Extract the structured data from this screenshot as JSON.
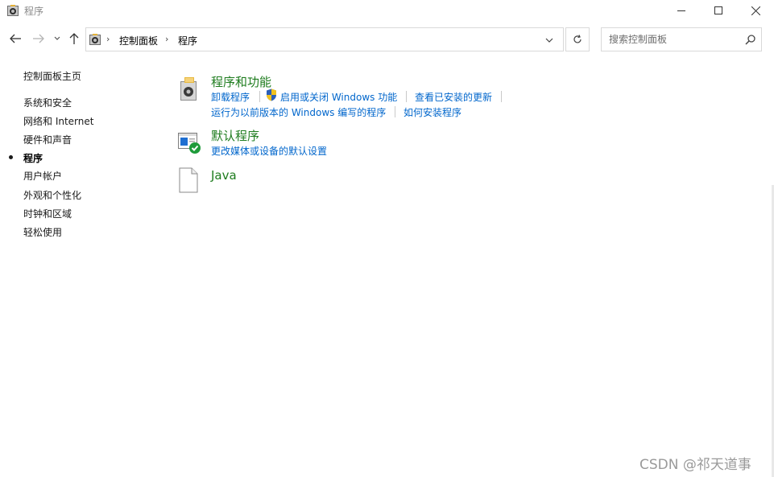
{
  "window": {
    "title": "程序",
    "icon": "control-panel-icon"
  },
  "window_controls": {
    "minimize": "minimize-icon",
    "maximize": "maximize-icon",
    "close": "close-icon"
  },
  "address": {
    "breadcrumbs": [
      "控制面板",
      "程序"
    ],
    "search_placeholder": "搜索控制面板"
  },
  "sidebar": {
    "items": [
      {
        "label": "控制面板主页",
        "current": false
      },
      {
        "label": "系统和安全",
        "current": false
      },
      {
        "label": "网络和 Internet",
        "current": false
      },
      {
        "label": "硬件和声音",
        "current": false
      },
      {
        "label": "程序",
        "current": true
      },
      {
        "label": "用户帐户",
        "current": false
      },
      {
        "label": "外观和个性化",
        "current": false
      },
      {
        "label": "时钟和区域",
        "current": false
      },
      {
        "label": "轻松使用",
        "current": false
      }
    ]
  },
  "groups": {
    "programs_features": {
      "title": "程序和功能",
      "icon": "programs-features-icon",
      "links": [
        "卸载程序",
        "启用或关闭 Windows 功能",
        "查看已安装的更新",
        "运行为以前版本的 Windows 编写的程序",
        "如何安装程序"
      ],
      "shield_link_icon": "uac-shield-icon"
    },
    "default_programs": {
      "title": "默认程序",
      "icon": "default-programs-icon",
      "links": [
        "更改媒体或设备的默认设置"
      ]
    },
    "java": {
      "title": "Java",
      "icon": "java-file-icon"
    }
  },
  "watermark": "CSDN @祁天道事",
  "colors": {
    "group_title": "#1e7c1e",
    "link": "#0066cc"
  }
}
